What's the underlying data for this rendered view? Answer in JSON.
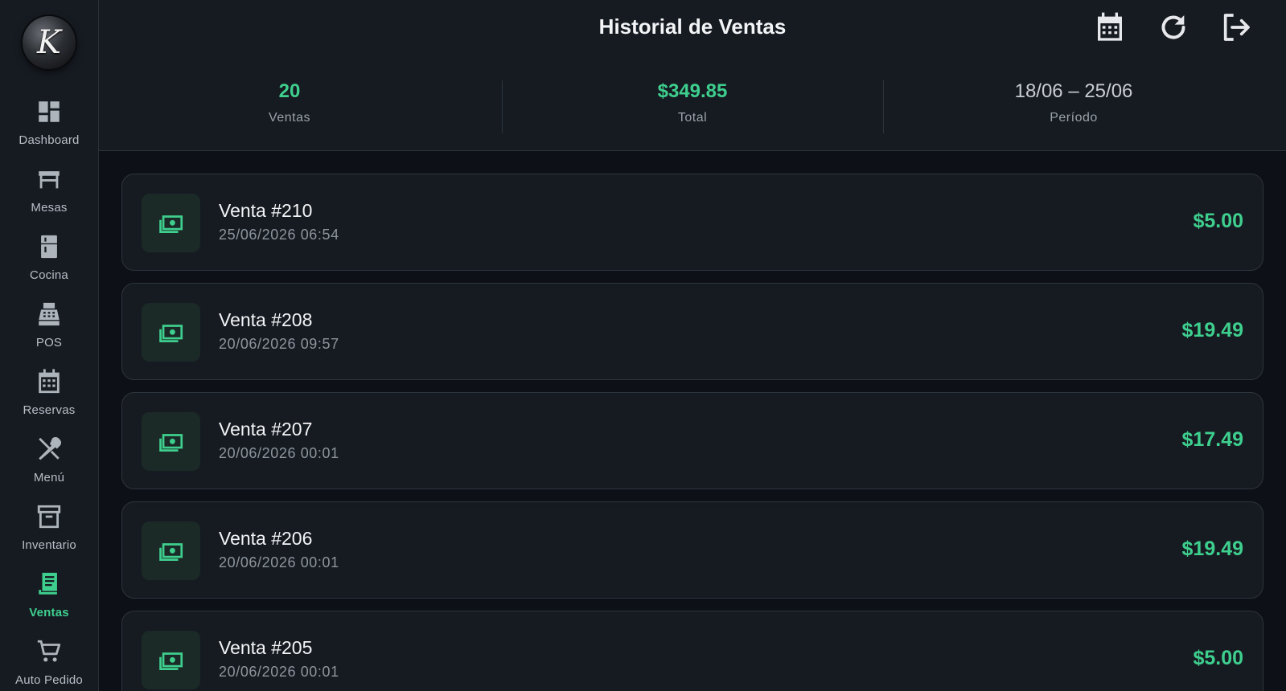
{
  "app": {
    "logo_letter": "K",
    "accent_color": "#3ecf8e"
  },
  "sidebar": {
    "items": [
      {
        "label": "Dashboard",
        "icon": "dashboard-icon",
        "active": false
      },
      {
        "label": "Mesas",
        "icon": "table-icon",
        "active": false
      },
      {
        "label": "Cocina",
        "icon": "fridge-icon",
        "active": false
      },
      {
        "label": "POS",
        "icon": "cash-register-icon",
        "active": false
      },
      {
        "label": "Reservas",
        "icon": "calendar-icon",
        "active": false
      },
      {
        "label": "Menú",
        "icon": "utensils-icon",
        "active": false
      },
      {
        "label": "Inventario",
        "icon": "archive-box-icon",
        "active": false
      },
      {
        "label": "Ventas",
        "icon": "receipt-icon",
        "active": true
      },
      {
        "label": "Auto Pedido",
        "icon": "cart-icon",
        "active": false
      }
    ]
  },
  "header": {
    "title": "Historial de Ventas",
    "actions": [
      "calendar-icon",
      "refresh-icon",
      "logout-icon"
    ]
  },
  "stats": {
    "count_value": "20",
    "count_label": "Ventas",
    "total_value": "$349.85",
    "total_label": "Total",
    "period_value": "18/06 – 25/06",
    "period_label": "Período"
  },
  "sales": [
    {
      "name": "Venta #210",
      "date": "25/06/2026 06:54",
      "amount": "$5.00"
    },
    {
      "name": "Venta #208",
      "date": "20/06/2026 09:57",
      "amount": "$19.49"
    },
    {
      "name": "Venta #207",
      "date": "20/06/2026 00:01",
      "amount": "$17.49"
    },
    {
      "name": "Venta #206",
      "date": "20/06/2026 00:01",
      "amount": "$19.49"
    },
    {
      "name": "Venta #205",
      "date": "20/06/2026 00:01",
      "amount": "$5.00"
    }
  ]
}
